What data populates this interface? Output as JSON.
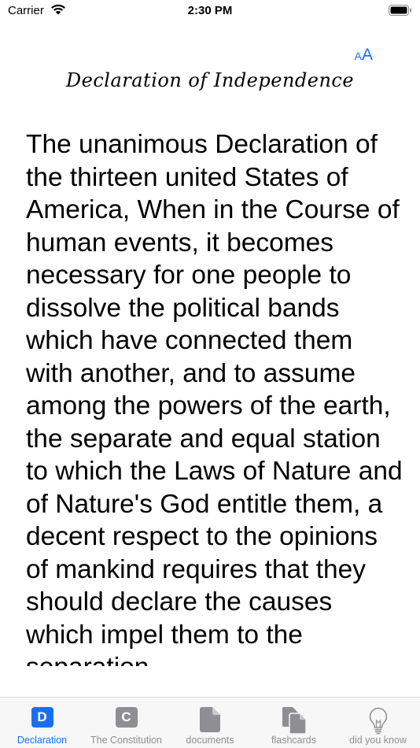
{
  "status_bar": {
    "carrier": "Carrier",
    "time": "2:30 PM"
  },
  "toolbar": {
    "font_size_small": "A",
    "font_size_large": "A"
  },
  "title": "Declaration of Independence",
  "body_text": "The unanimous Declaration of the thirteen united States of America, When in the Course of human events, it becomes necessary for one people to dissolve the political bands which have connected them with another, and to assume among the powers of the earth, the separate and equal station to which the Laws of Nature and of Nature's God entitle them, a decent respect to the opinions of mankind requires that they should declare the causes which impel them to the separation.",
  "tabs": [
    {
      "label": "Declaration",
      "icon": "d-letter-icon",
      "letter": "D",
      "active": true
    },
    {
      "label": "The Constitution",
      "icon": "c-letter-icon",
      "letter": "C",
      "active": false
    },
    {
      "label": "documents",
      "icon": "document-icon",
      "active": false
    },
    {
      "label": "flashcards",
      "icon": "cards-icon",
      "active": false
    },
    {
      "label": "did you know",
      "icon": "lightbulb-icon",
      "active": false
    }
  ],
  "colors": {
    "accent": "#1a6ff0",
    "inactive": "#8e8e93",
    "tab_bar_bg": "#f7f7f7"
  }
}
